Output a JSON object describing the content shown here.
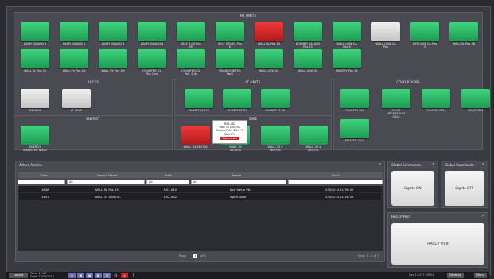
{
  "panels": {
    "ht_units": "HT UNITS",
    "racks": "RACKS",
    "lt_units": "LT UNITS",
    "cold_rooms": "COLD ROOMS",
    "energy": "ENERGY",
    "sim2": "SIM2"
  },
  "ht_row1": [
    "DAIRY ISLAND 1",
    "DAIRY ISLAND 2",
    "DAIRY ISLAND 3",
    "DAIRY ISLAND 4",
    "SELF S.CS Pos\n8M",
    "SELF S PAST. Pos\n8",
    "WALL SL Pos 15",
    "KORNER SALADS\nPos 15",
    "WALL LOW CA\nPos 4",
    "WALL LOW CA\nPos",
    "REF.CASE CA Pos\n5",
    "WALL SL Pos 3N"
  ],
  "ht_row2": [
    "WALL SL Pos 25",
    "WALL FV Pos 2N",
    "WALL FV Pos 3M",
    "COUNTER CA\nPos 1 ex",
    "COUNTER CA\nPos. 2 dx",
    "REARCOUNTER\nPos1",
    "WALL LOW SL",
    "WALL LOW SL",
    "BAKERY Pos 14"
  ],
  "racks": [
    "TN RACK",
    "LT RACK"
  ],
  "lt_units": [
    "CLOSET LT LFT",
    "CLOSET LT RT",
    "CLOSET LT CE"
  ],
  "cold_rooms": [
    "POULTRY RHI",
    "FRUIT\nVEGETABLES\nCELL",
    "POULTRY CELL",
    "MEAT CELL",
    "FROZEN CELL"
  ],
  "energy": [
    "ENERGY\nANALYZER NM22"
  ],
  "sim2": [
    "WALL 33 XB570C",
    "WALL 3S\nXB70CS",
    "WALL 33 5\nXB570C",
    "WALL 33 4\nXB570C"
  ],
  "popup": {
    "line1": "R52-082",
    "line2": "Wall 33 XB570C",
    "line3": "Room (Pb1): 23.4 °C",
    "line4": "Stat: Pin",
    "tag": "Open Door"
  },
  "alarms": {
    "title": "Active Alarms",
    "columns": [
      "Code",
      "Device Name",
      "Addr.",
      "Name",
      "Start"
    ],
    "filter_values": [
      "",
      "All",
      "All",
      "All",
      ""
    ],
    "rows": [
      [
        "1648",
        "WALL SL Pos 15",
        "R51-010",
        "Low Value Pb1",
        "23/05/14 11:36:40"
      ],
      [
        "1647",
        "WALL 33 XB570C",
        "R52-082",
        "Open Door",
        "23/05/14 11:26:39"
      ]
    ],
    "page_label": "Page",
    "page_value": "1",
    "page_of": "of 1",
    "view_label": "View 1 - 2 of 2"
  },
  "global1": {
    "title": "Global Commands",
    "button": "Lights ON"
  },
  "global2": {
    "title": "Global Commands",
    "button": "Lights OFF"
  },
  "haccp": {
    "title": "HACCP Print",
    "button": "HACCP Print"
  },
  "taskbar": {
    "logout": "Logout",
    "time_line1": "Time: 11:27",
    "time_line2": "Date: 23/05/2014",
    "version": "Rev 1.0.027-XR504",
    "desktop": "Desktop",
    "menu": "Menu"
  }
}
